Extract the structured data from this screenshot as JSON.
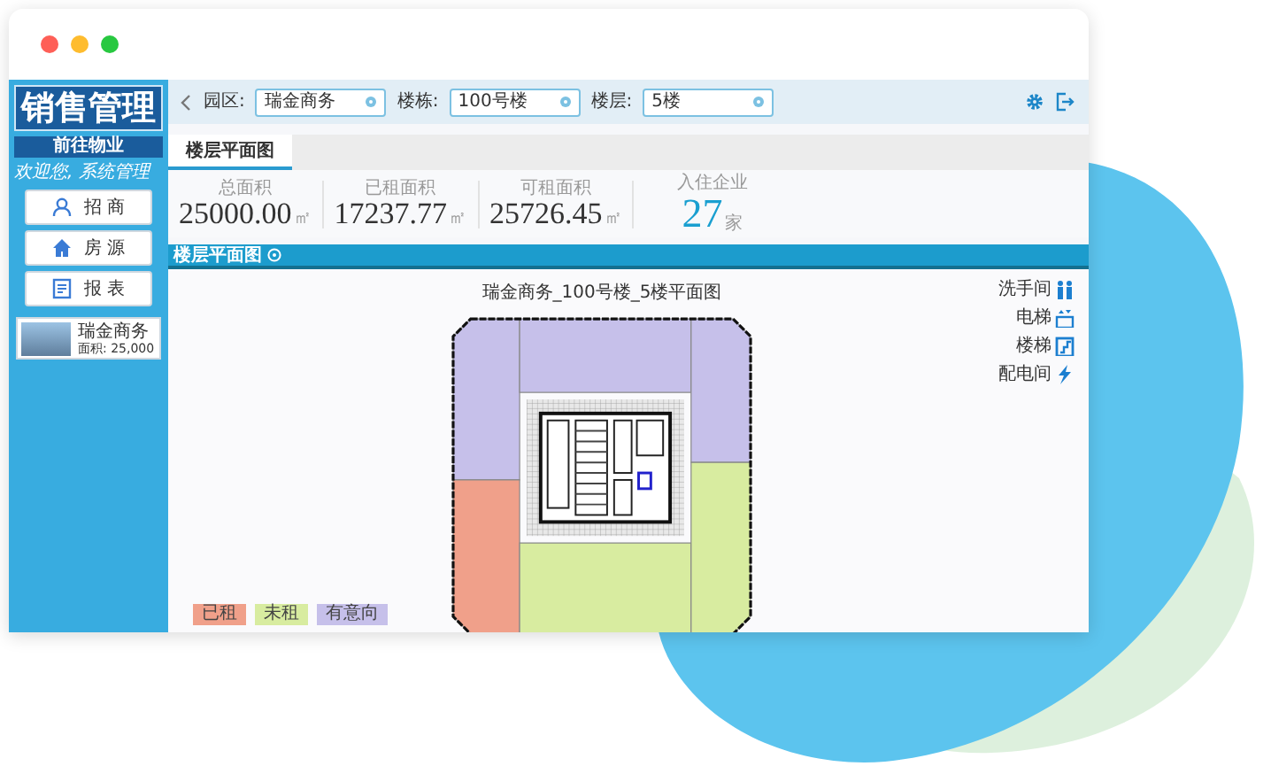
{
  "window_controls": [
    {
      "color": "#fe5f57"
    },
    {
      "color": "#febc2e"
    },
    {
      "color": "#28c840"
    }
  ],
  "sidebar": {
    "title": "销售管理",
    "subtitle": "前往物业",
    "welcome": "欢迎您, 系统管理",
    "nav": [
      {
        "label": "招 商",
        "kind": "user"
      },
      {
        "label": "房 源",
        "kind": "home"
      },
      {
        "label": "报 表",
        "kind": "report"
      }
    ],
    "project_card": {
      "name": "瑞金商务",
      "area": "面积: 25,000"
    }
  },
  "toolbar": {
    "filters": [
      {
        "label": "园区:",
        "value": "瑞金商务"
      },
      {
        "label": "楼栋:",
        "value": "100号楼"
      },
      {
        "label": "楼层:",
        "value": "5楼"
      }
    ]
  },
  "tabs": [
    {
      "label": "楼层平面图",
      "selected": true
    }
  ],
  "stats": [
    {
      "kind": "area",
      "label": "总面积",
      "value": "25000.00",
      "unit": "㎡"
    },
    {
      "kind": "area",
      "label": "已租面积",
      "value": "17237.77",
      "unit": "㎡"
    },
    {
      "kind": "area",
      "label": "可租面积",
      "value": "25726.45",
      "unit": "㎡"
    },
    {
      "kind": "count",
      "label": "入住企业",
      "value": "27",
      "unit": "家"
    }
  ],
  "section_title": "楼层平面图",
  "plan": {
    "title": "瑞金商务_100号楼_5楼平面图",
    "facility_legend": [
      {
        "label": "洗手间",
        "kind": "restroom"
      },
      {
        "label": "电梯",
        "kind": "elevator"
      },
      {
        "label": "楼梯",
        "kind": "stairs"
      },
      {
        "label": "配电间",
        "kind": "power"
      }
    ],
    "rooms": [
      {
        "color": "#c6c0ea"
      },
      {
        "color": "#c6c0ea"
      },
      {
        "color": "#c6c0ea"
      },
      {
        "color": "#f0a08a"
      },
      {
        "color": "#d8eca0"
      },
      {
        "color": "#d8eca0"
      }
    ],
    "status_legend": [
      {
        "label": "已租",
        "color": "#f0a08a"
      },
      {
        "label": "未租",
        "color": "#d8eca0"
      },
      {
        "label": "有意向",
        "color": "#c6c0ea"
      }
    ]
  }
}
